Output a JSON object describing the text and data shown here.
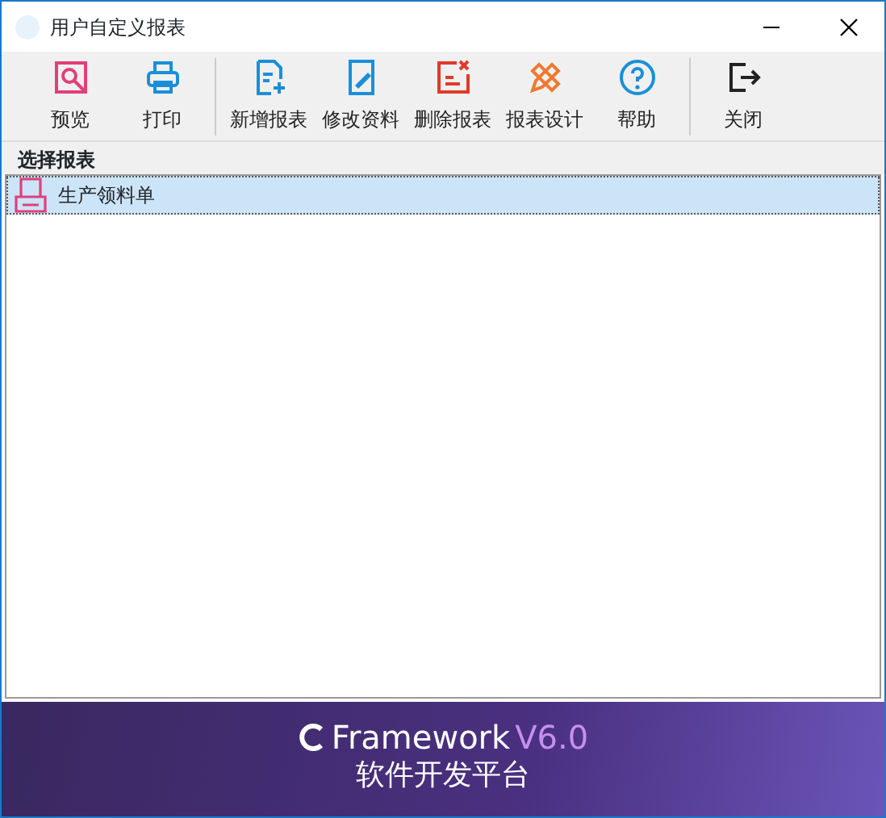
{
  "window": {
    "title": "用户自定义报表"
  },
  "toolbar": [
    [
      {
        "kind": "preview",
        "label": "预览"
      },
      {
        "kind": "print",
        "label": "打印"
      }
    ],
    [
      {
        "kind": "add",
        "label": "新增报表"
      },
      {
        "kind": "edit",
        "label": "修改资料"
      },
      {
        "kind": "delete",
        "label": "删除报表"
      },
      {
        "kind": "design",
        "label": "报表设计"
      },
      {
        "kind": "help",
        "label": "帮助"
      }
    ],
    [
      {
        "kind": "close",
        "label": "关闭"
      }
    ]
  ],
  "list": {
    "header": "选择报表",
    "items": [
      {
        "label": "生产领料单",
        "selected": true
      }
    ]
  },
  "banner": {
    "brand": "Framework",
    "version": "V6.0",
    "subtitle": "软件开发平台"
  }
}
